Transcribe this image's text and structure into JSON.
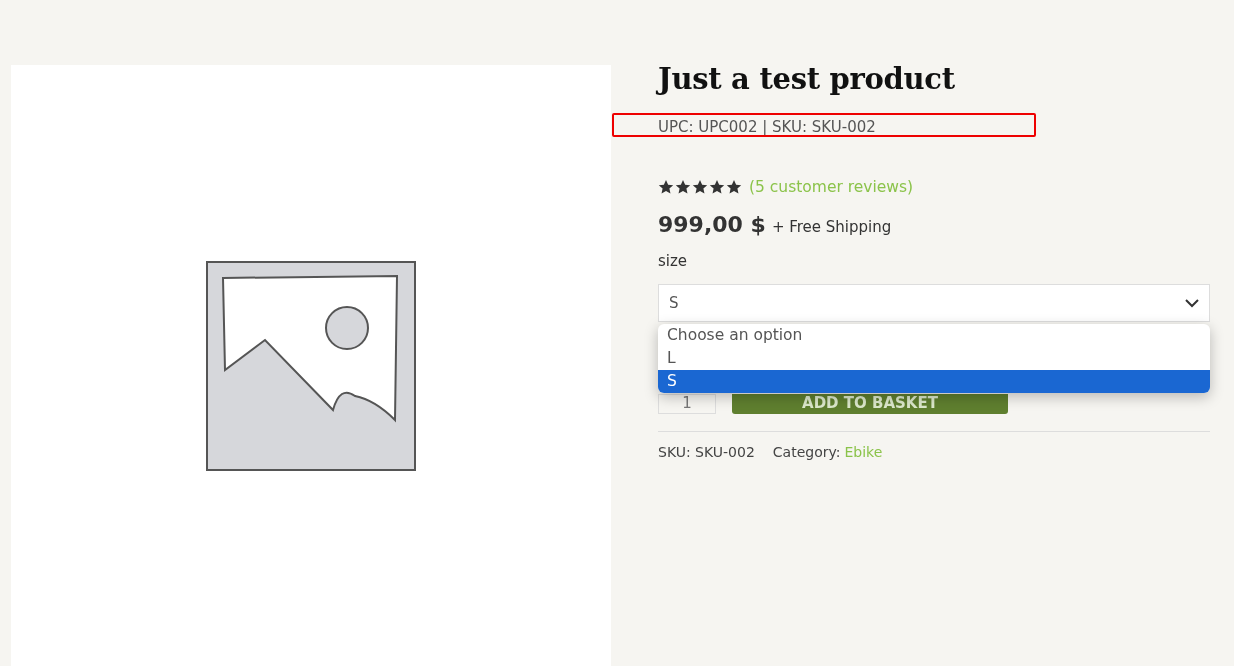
{
  "product": {
    "title": "Just a test product",
    "codes": "UPC: UPC002 | SKU: SKU-002",
    "highlighted": true,
    "stars": 5,
    "reviews_link": "(5 customer reviews)",
    "price": "999,00 $",
    "shipping": "+ Free Shipping",
    "variation": {
      "label": "size",
      "value": "S",
      "open": true,
      "options": [
        {
          "label": "Choose an option",
          "selected": false
        },
        {
          "label": "L",
          "selected": false
        },
        {
          "label": "S",
          "selected": true
        }
      ]
    },
    "quantity": "1",
    "add_button": "ADD TO BASKET",
    "meta": {
      "sku": "SKU: SKU-002",
      "category_label": "Category:",
      "category": "Ebike"
    }
  }
}
